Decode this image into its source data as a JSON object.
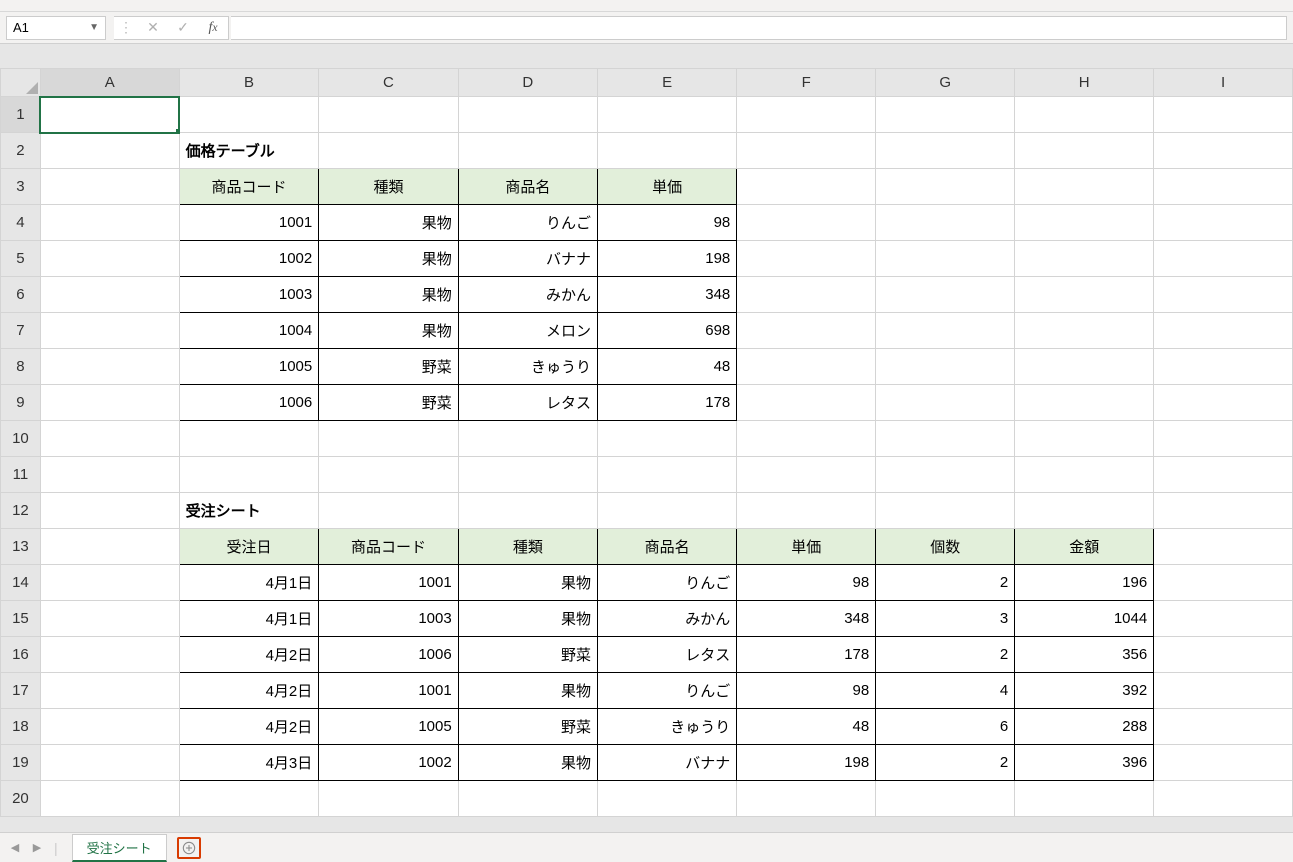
{
  "name_box": "A1",
  "columns": [
    "A",
    "B",
    "C",
    "D",
    "E",
    "F",
    "G",
    "H",
    "I"
  ],
  "rows": [
    "1",
    "2",
    "3",
    "4",
    "5",
    "6",
    "7",
    "8",
    "9",
    "10",
    "11",
    "12",
    "13",
    "14",
    "15",
    "16",
    "17",
    "18",
    "19",
    "20"
  ],
  "selected_cell": "A1",
  "sheet_tab": "受注シート",
  "table1": {
    "title": "価格テーブル",
    "headers": [
      "商品コード",
      "種類",
      "商品名",
      "単価"
    ],
    "rows": [
      [
        "1001",
        "果物",
        "りんご",
        "98"
      ],
      [
        "1002",
        "果物",
        "バナナ",
        "198"
      ],
      [
        "1003",
        "果物",
        "みかん",
        "348"
      ],
      [
        "1004",
        "果物",
        "メロン",
        "698"
      ],
      [
        "1005",
        "野菜",
        "きゅうり",
        "48"
      ],
      [
        "1006",
        "野菜",
        "レタス",
        "178"
      ]
    ]
  },
  "table2": {
    "title": "受注シート",
    "headers": [
      "受注日",
      "商品コード",
      "種類",
      "商品名",
      "単価",
      "個数",
      "金額"
    ],
    "rows": [
      [
        "4月1日",
        "1001",
        "果物",
        "りんご",
        "98",
        "2",
        "196"
      ],
      [
        "4月1日",
        "1003",
        "果物",
        "みかん",
        "348",
        "3",
        "1044"
      ],
      [
        "4月2日",
        "1006",
        "野菜",
        "レタス",
        "178",
        "2",
        "356"
      ],
      [
        "4月2日",
        "1001",
        "果物",
        "りんご",
        "98",
        "4",
        "392"
      ],
      [
        "4月2日",
        "1005",
        "野菜",
        "きゅうり",
        "48",
        "6",
        "288"
      ],
      [
        "4月3日",
        "1002",
        "果物",
        "バナナ",
        "198",
        "2",
        "396"
      ]
    ]
  }
}
